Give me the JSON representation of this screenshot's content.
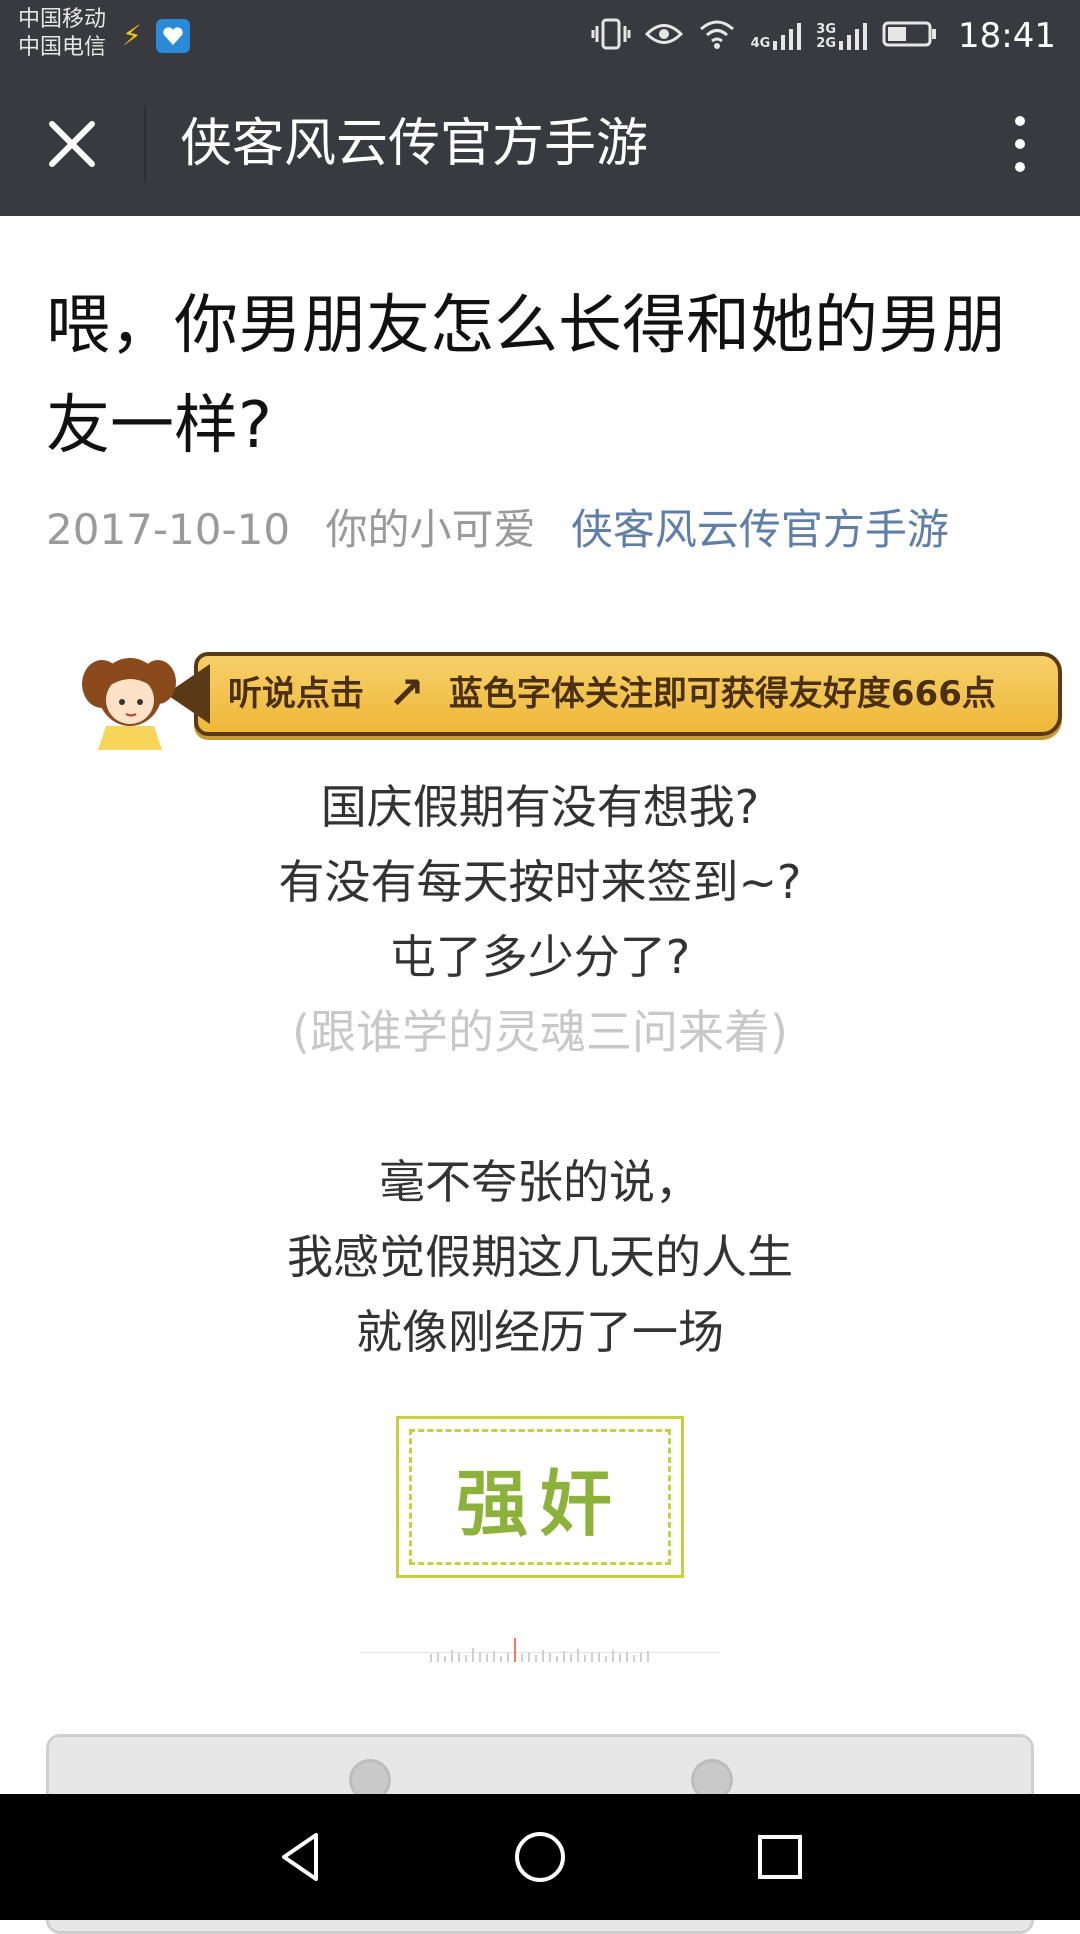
{
  "status_bar": {
    "carriers": [
      "中国移动",
      "中国电信"
    ],
    "network_4g": "4G",
    "network_3g": "3G",
    "network_2g": "2G",
    "time": "18:41"
  },
  "nav": {
    "title": "侠客风云传官方手游"
  },
  "article": {
    "title": "喂，你男朋友怎么长得和她的男朋友一样?",
    "date": "2017-10-10",
    "author": "你的小可爱",
    "account": "侠客风云传官方手游"
  },
  "banner": {
    "text_left": "听说点击",
    "text_right": "蓝色字体关注即可获得友好度666点"
  },
  "body": {
    "para1": [
      "国庆假期有没有想我?",
      "有没有每天按时来签到~?",
      "屯了多少分了?"
    ],
    "aside": "(跟谁学的灵魂三问来着)",
    "para2": [
      "毫不夸张的说，",
      "我感觉假期这几天的人生",
      "就像刚经历了一场"
    ],
    "stamp": "强奸"
  },
  "colors": {
    "toolbar": "#393a3f",
    "link_blue": "#5f7ea8",
    "stamp_green": "#8db23c",
    "stamp_border": "#c8ce3c"
  },
  "icons": {
    "close": "close-icon",
    "more": "more-vertical-icon",
    "back": "back-triangle-icon",
    "home": "home-circle-icon",
    "recents": "recents-square-icon"
  }
}
